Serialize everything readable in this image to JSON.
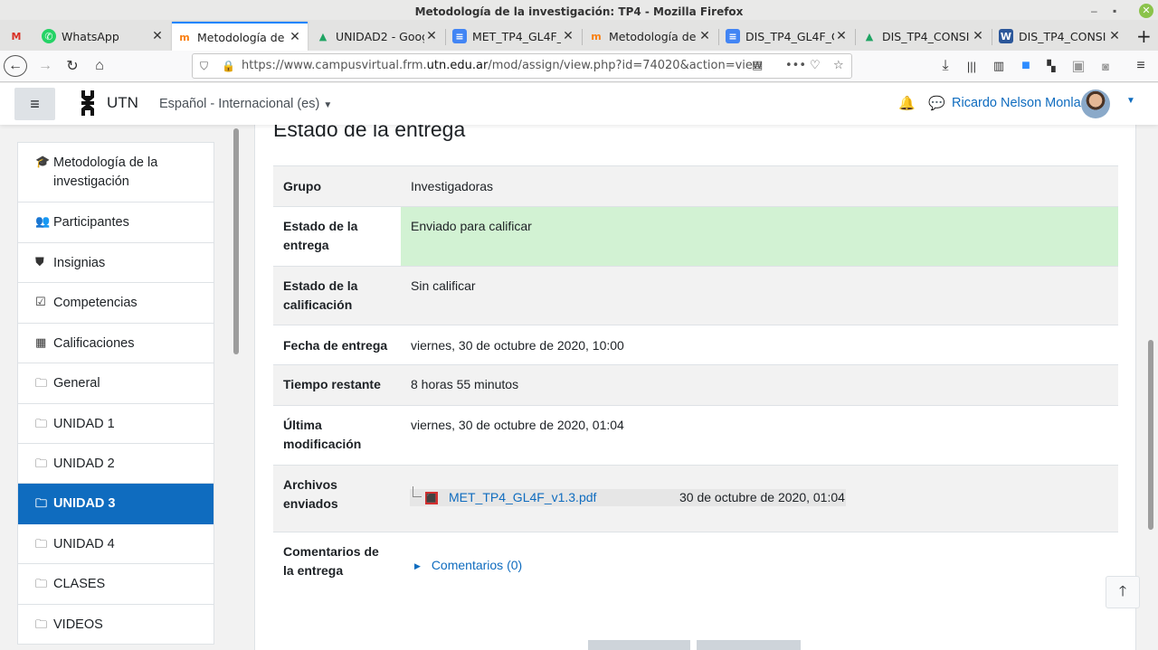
{
  "window": {
    "title": "Metodología de la investigación: TP4 - Mozilla Firefox"
  },
  "tabs": [
    {
      "icon": "gmail-icon",
      "label": ""
    },
    {
      "icon": "whatsapp-icon",
      "label": "WhatsApp"
    },
    {
      "icon": "moodle-icon",
      "label": "Metodología de ",
      "active": true
    },
    {
      "icon": "google-drive-icon",
      "label": "UNIDAD2 - Goog"
    },
    {
      "icon": "google-docs-icon",
      "label": "MET_TP4_GL4F_"
    },
    {
      "icon": "moodle-icon",
      "label": "Metodología de "
    },
    {
      "icon": "google-docs-icon",
      "label": "DIS_TP4_GL4F_C"
    },
    {
      "icon": "google-drive-icon",
      "label": "DIS_TP4_CONSI"
    },
    {
      "icon": "word-icon",
      "label": "DIS_TP4_CONSI"
    }
  ],
  "nav": {
    "url_prefix": "https://www.campusvirtual.frm.",
    "url_host": "utn.edu.ar",
    "url_rest": "/mod/assign/view.php?id=74020&action=view"
  },
  "header": {
    "brand": "UTN",
    "language": "Español - Internacional (es)",
    "user_name": "Ricardo Nelson Monla"
  },
  "sidebar": {
    "items": [
      {
        "icon": "graduation-cap-icon",
        "label": "Metodología de la investigación"
      },
      {
        "icon": "users-icon",
        "label": "Participantes"
      },
      {
        "icon": "shield-icon",
        "label": "Insignias"
      },
      {
        "icon": "check-square-icon",
        "label": "Competencias"
      },
      {
        "icon": "table-icon",
        "label": "Calificaciones"
      },
      {
        "icon": "folder-icon",
        "label": "General"
      },
      {
        "icon": "folder-icon",
        "label": "UNIDAD 1"
      },
      {
        "icon": "folder-icon",
        "label": "UNIDAD 2"
      },
      {
        "icon": "folder-icon",
        "label": "UNIDAD 3",
        "active": true
      },
      {
        "icon": "folder-icon",
        "label": "UNIDAD 4"
      },
      {
        "icon": "folder-icon",
        "label": "CLASES"
      },
      {
        "icon": "folder-icon",
        "label": "VIDEOS"
      }
    ]
  },
  "main": {
    "heading": "Estado de la entrega",
    "rows": [
      {
        "label": "Grupo",
        "value": "Investigadoras"
      },
      {
        "label": "Estado de la entrega",
        "value": "Enviado para calificar",
        "status_color": "#d2f2d3"
      },
      {
        "label": "Estado de la calificación",
        "value": "Sin calificar"
      },
      {
        "label": "Fecha de entrega",
        "value": "viernes, 30 de octubre de 2020, 10:00"
      },
      {
        "label": "Tiempo restante",
        "value": "8 horas 55 minutos"
      },
      {
        "label": "Última modificación",
        "value": "viernes, 30 de octubre de 2020, 01:04"
      },
      {
        "label": "Archivos enviados",
        "value": ""
      },
      {
        "label": "Comentarios de la entrega",
        "value": ""
      }
    ],
    "file": {
      "name": "MET_TP4_GL4F_v1.3.pdf",
      "date": "30 de octubre de 2020, 01:04"
    },
    "comments_link": "Comentarios (0)"
  },
  "colors": {
    "accent": "#0f6cbf",
    "submitted": "#d2f2d3"
  }
}
